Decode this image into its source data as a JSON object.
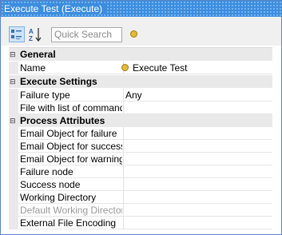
{
  "window": {
    "title": "Execute Test (Execute)"
  },
  "toolbar": {
    "categorized_icon": "categorized-view-icon",
    "alphabetical_icon": "alphabetical-sort-icon",
    "search_placeholder": "Quick Search",
    "help_icon": "help-coin-icon"
  },
  "colors": {
    "title_bar": "#3c8dde",
    "category_row": "#e9e9e9",
    "active_button": "#cfe3f7"
  },
  "categories": [
    {
      "name": "General",
      "properties": [
        {
          "name": "Name",
          "value": "Execute Test",
          "icon": "object-coin-icon"
        }
      ]
    },
    {
      "name": "Execute Settings",
      "properties": [
        {
          "name": "Failure type",
          "value": "Any"
        },
        {
          "name": "File with list of commands",
          "value": ""
        }
      ]
    },
    {
      "name": "Process Attributes",
      "properties": [
        {
          "name": "Email Object for failure",
          "value": ""
        },
        {
          "name": "Email Object for success",
          "value": ""
        },
        {
          "name": "Email Object for warning",
          "value": ""
        },
        {
          "name": "Failure node",
          "value": ""
        },
        {
          "name": "Success node",
          "value": ""
        },
        {
          "name": "Working Directory",
          "value": ""
        },
        {
          "name": "Default Working Directory",
          "value": "",
          "disabled": true
        },
        {
          "name": "External File Encoding",
          "value": ""
        }
      ]
    }
  ]
}
